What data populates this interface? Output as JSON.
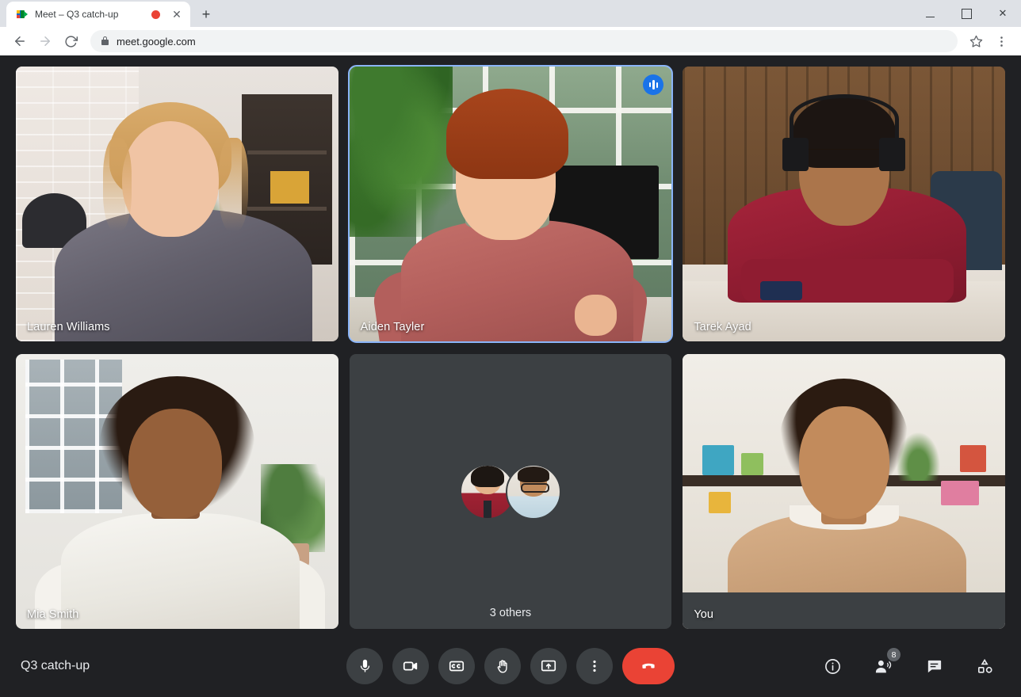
{
  "browser": {
    "tab": {
      "title": "Meet – Q3 catch-up",
      "favicon_name": "google-meet-favicon",
      "recording_indicator": "recording-dot",
      "close_label": "✕"
    },
    "new_tab_label": "+",
    "window_controls": {
      "minimize": "minimize-button",
      "maximize": "maximize-button",
      "close": "✕"
    },
    "nav": {
      "back": "←",
      "forward": "→",
      "reload": "reload-icon"
    },
    "omnibox": {
      "url": "meet.google.com",
      "lock": "secure-lock-icon"
    },
    "actions": {
      "bookmark": "star-icon",
      "menu": "⋮"
    }
  },
  "meeting": {
    "title": "Q3 catch-up",
    "tiles": [
      {
        "name": "Lauren Williams",
        "kind": "video",
        "speaking": false
      },
      {
        "name": "Aiden Tayler",
        "kind": "video",
        "speaking": true
      },
      {
        "name": "Tarek Ayad",
        "kind": "video",
        "speaking": false
      },
      {
        "name": "Mia Smith",
        "kind": "video",
        "speaking": false
      },
      {
        "name": "3 others",
        "kind": "overflow",
        "speaking": false
      },
      {
        "name": "You",
        "kind": "self",
        "speaking": false
      }
    ],
    "controls": [
      {
        "id": "microphone",
        "label": "microphone-icon"
      },
      {
        "id": "camera",
        "label": "camera-icon"
      },
      {
        "id": "captions",
        "label": "captions-icon"
      },
      {
        "id": "raise-hand",
        "label": "raise-hand-icon"
      },
      {
        "id": "present",
        "label": "present-screen-icon"
      },
      {
        "id": "more-options",
        "label": "more-options-icon"
      },
      {
        "id": "leave-call",
        "label": "leave-call-icon"
      }
    ],
    "right_controls": [
      {
        "id": "meeting-details",
        "label": "info-icon",
        "badge": ""
      },
      {
        "id": "people",
        "label": "people-icon",
        "badge": "8"
      },
      {
        "id": "chat",
        "label": "chat-icon",
        "badge": ""
      },
      {
        "id": "activities",
        "label": "activities-icon",
        "badge": ""
      }
    ]
  },
  "colors": {
    "stage_bg": "#202124",
    "tile_bg": "#3c4043",
    "accent_blue": "#1a73e8",
    "active_border": "#8ab4f8",
    "hangup_red": "#ea4335"
  }
}
